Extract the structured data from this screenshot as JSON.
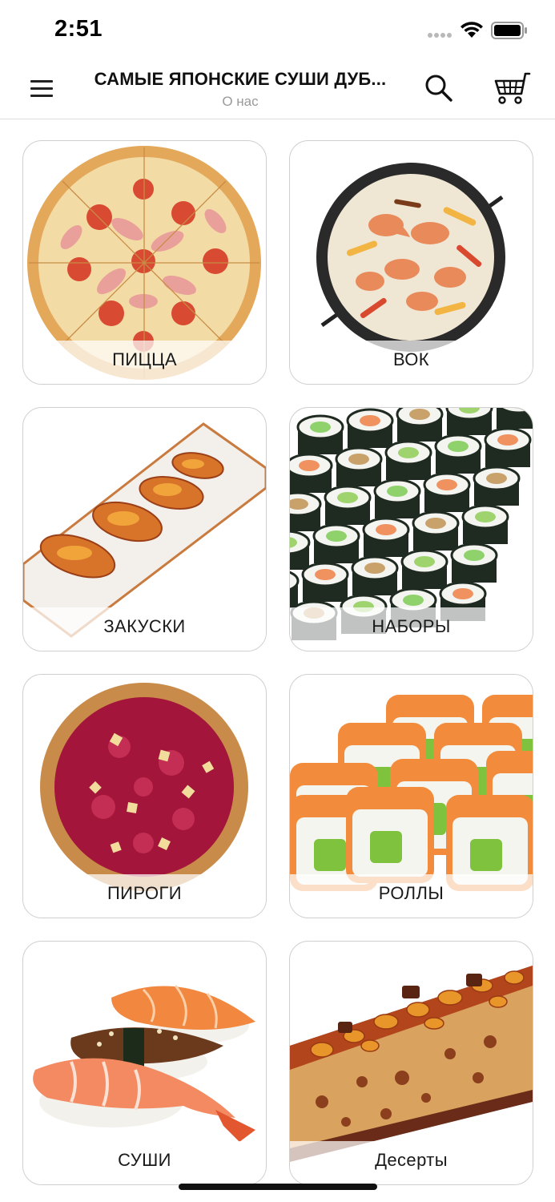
{
  "status_bar": {
    "time": "2:51",
    "icons": [
      "signal-icon",
      "wifi-icon",
      "battery-icon"
    ]
  },
  "header": {
    "title": "САМЫЕ ЯПОНСКИЕ СУШИ ДУБ...",
    "subtitle": "О нас",
    "icons": [
      "menu-icon",
      "search-icon",
      "cart-icon"
    ]
  },
  "categories": [
    {
      "label": "ПИЦЦА",
      "image": "pizza-image"
    },
    {
      "label": "ВОК",
      "image": "wok-image"
    },
    {
      "label": "ЗАКУСКИ",
      "image": "snacks-image"
    },
    {
      "label": "НАБОРЫ",
      "image": "sets-image"
    },
    {
      "label": "ПИРОГИ",
      "image": "pies-image"
    },
    {
      "label": "РОЛЛЫ",
      "image": "rolls-image"
    },
    {
      "label": "СУШИ",
      "image": "sushi-image"
    },
    {
      "label": "Десерты",
      "image": "desserts-image"
    }
  ],
  "colors": {
    "accent_text": "#111111",
    "subtitle": "#9a9a9a",
    "card_border": "#cfcfcf"
  }
}
